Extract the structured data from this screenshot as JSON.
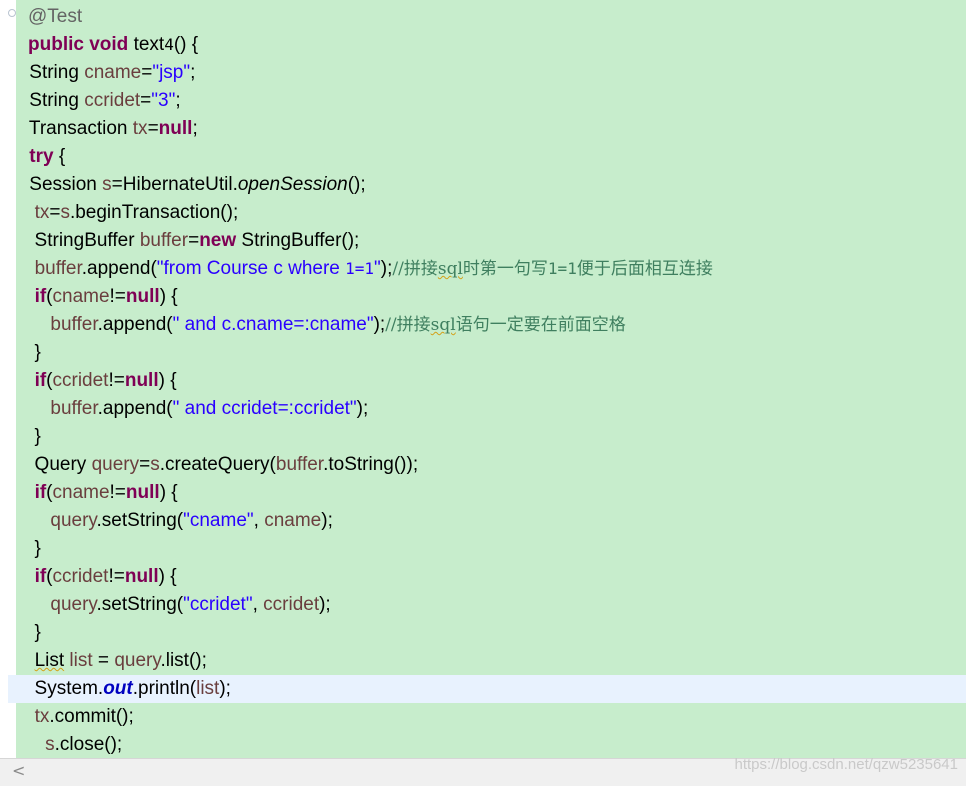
{
  "editor": {
    "lines": [
      {
        "tokens": [
          {
            "t": "@Test",
            "c": "ann"
          }
        ]
      },
      {
        "tokens": [
          {
            "t": "public",
            "c": "kw"
          },
          {
            "t": " "
          },
          {
            "t": "void",
            "c": "kw"
          },
          {
            "t": " text"
          },
          {
            "t": "4",
            "c": "num"
          },
          {
            "t": "() {"
          }
        ]
      },
      {
        "tokens": [
          {
            "t": " String "
          },
          {
            "t": "cname",
            "c": "var"
          },
          {
            "t": "="
          },
          {
            "t": "\"jsp\"",
            "c": "str"
          },
          {
            "t": ";"
          }
        ]
      },
      {
        "tokens": [
          {
            "t": " String "
          },
          {
            "t": "ccridet",
            "c": "var"
          },
          {
            "t": "="
          },
          {
            "t": "\"3\"",
            "c": "str"
          },
          {
            "t": ";"
          }
        ]
      },
      {
        "tokens": [
          {
            "t": " Transaction "
          },
          {
            "t": "tx",
            "c": "var"
          },
          {
            "t": "="
          },
          {
            "t": "null",
            "c": "kw"
          },
          {
            "t": ";"
          }
        ]
      },
      {
        "tokens": [
          {
            "t": " "
          },
          {
            "t": "try",
            "c": "kw"
          },
          {
            "t": " {"
          }
        ]
      },
      {
        "tokens": [
          {
            "t": " Session "
          },
          {
            "t": "s",
            "c": "var"
          },
          {
            "t": "=HibernateUtil."
          },
          {
            "t": "openSession",
            "c": "it"
          },
          {
            "t": "();"
          }
        ]
      },
      {
        "tokens": [
          {
            "t": "  "
          },
          {
            "t": "tx",
            "c": "var"
          },
          {
            "t": "="
          },
          {
            "t": "s",
            "c": "var"
          },
          {
            "t": ".beginTransaction();"
          }
        ]
      },
      {
        "tokens": [
          {
            "t": "  StringBuffer "
          },
          {
            "t": "buffer",
            "c": "var"
          },
          {
            "t": "="
          },
          {
            "t": "new",
            "c": "kw"
          },
          {
            "t": " StringBuffer();"
          }
        ]
      },
      {
        "tokens": [
          {
            "t": "  "
          },
          {
            "t": "buffer",
            "c": "var"
          },
          {
            "t": ".append("
          },
          {
            "t": "\"from Course c where ",
            "c": "str"
          },
          {
            "t": "1=1",
            "c": "str num"
          },
          {
            "t": "\"",
            "c": "str"
          },
          {
            "t": ");"
          },
          {
            "t": "//拼接",
            "c": "cmt"
          },
          {
            "t": "sql",
            "c": "cmt squig"
          },
          {
            "t": "时第一句写",
            "c": "cmt"
          },
          {
            "t": "1=1",
            "c": "cmt num"
          },
          {
            "t": "便于后面相互连接",
            "c": "cmt"
          }
        ]
      },
      {
        "tokens": [
          {
            "t": "  "
          },
          {
            "t": "if",
            "c": "kw"
          },
          {
            "t": "("
          },
          {
            "t": "cname",
            "c": "var"
          },
          {
            "t": "!="
          },
          {
            "t": "null",
            "c": "kw"
          },
          {
            "t": ") {"
          }
        ]
      },
      {
        "tokens": [
          {
            "t": "     "
          },
          {
            "t": "buffer",
            "c": "var"
          },
          {
            "t": ".append("
          },
          {
            "t": "\" and c.cname=:cname\"",
            "c": "str"
          },
          {
            "t": ");"
          },
          {
            "t": "//拼接",
            "c": "cmt"
          },
          {
            "t": "sql",
            "c": "cmt squig"
          },
          {
            "t": "语句一定要在前面空格",
            "c": "cmt"
          }
        ]
      },
      {
        "tokens": [
          {
            "t": "  }"
          }
        ]
      },
      {
        "tokens": [
          {
            "t": "  "
          },
          {
            "t": "if",
            "c": "kw"
          },
          {
            "t": "("
          },
          {
            "t": "ccridet",
            "c": "var"
          },
          {
            "t": "!="
          },
          {
            "t": "null",
            "c": "kw"
          },
          {
            "t": ") {"
          }
        ]
      },
      {
        "tokens": [
          {
            "t": "     "
          },
          {
            "t": "buffer",
            "c": "var"
          },
          {
            "t": ".append("
          },
          {
            "t": "\" and ccridet=:ccridet\"",
            "c": "str"
          },
          {
            "t": ");"
          }
        ]
      },
      {
        "tokens": [
          {
            "t": "  }"
          }
        ]
      },
      {
        "tokens": [
          {
            "t": "  Query "
          },
          {
            "t": "query",
            "c": "var"
          },
          {
            "t": "="
          },
          {
            "t": "s",
            "c": "var"
          },
          {
            "t": ".createQuery("
          },
          {
            "t": "buffer",
            "c": "var"
          },
          {
            "t": ".toString());"
          }
        ]
      },
      {
        "tokens": [
          {
            "t": "  "
          },
          {
            "t": "if",
            "c": "kw"
          },
          {
            "t": "("
          },
          {
            "t": "cname",
            "c": "var"
          },
          {
            "t": "!="
          },
          {
            "t": "null",
            "c": "kw"
          },
          {
            "t": ") {"
          }
        ]
      },
      {
        "tokens": [
          {
            "t": "     "
          },
          {
            "t": "query",
            "c": "var"
          },
          {
            "t": ".setString("
          },
          {
            "t": "\"cname\"",
            "c": "str"
          },
          {
            "t": ", "
          },
          {
            "t": "cname",
            "c": "var"
          },
          {
            "t": ");"
          }
        ]
      },
      {
        "tokens": [
          {
            "t": "  }"
          }
        ]
      },
      {
        "tokens": [
          {
            "t": "  "
          },
          {
            "t": "if",
            "c": "kw"
          },
          {
            "t": "("
          },
          {
            "t": "ccridet",
            "c": "var"
          },
          {
            "t": "!="
          },
          {
            "t": "null",
            "c": "kw"
          },
          {
            "t": ") {"
          }
        ]
      },
      {
        "tokens": [
          {
            "t": "     "
          },
          {
            "t": "query",
            "c": "var"
          },
          {
            "t": ".setString("
          },
          {
            "t": "\"ccridet\"",
            "c": "str"
          },
          {
            "t": ", "
          },
          {
            "t": "ccridet",
            "c": "var"
          },
          {
            "t": ");"
          }
        ]
      },
      {
        "tokens": [
          {
            "t": "  }"
          }
        ]
      },
      {
        "tokens": [
          {
            "t": "  "
          },
          {
            "t": "List",
            "c": "squig"
          },
          {
            "t": " "
          },
          {
            "t": "list",
            "c": "var"
          },
          {
            "t": " = "
          },
          {
            "t": "query",
            "c": "var"
          },
          {
            "t": ".list();"
          }
        ]
      },
      {
        "tokens": [
          {
            "t": "  System."
          },
          {
            "t": "out",
            "c": "fld"
          },
          {
            "t": ".println("
          },
          {
            "t": "list",
            "c": "var"
          },
          {
            "t": ");"
          }
        ],
        "current": true
      },
      {
        "tokens": [
          {
            "t": "  "
          },
          {
            "t": "tx",
            "c": "var"
          },
          {
            "t": ".commit();"
          }
        ]
      },
      {
        "tokens": [
          {
            "t": "    "
          },
          {
            "t": "s",
            "c": "var"
          },
          {
            "t": ".close();"
          }
        ]
      }
    ]
  },
  "scrollbar": {
    "left_arrow": "<"
  },
  "watermark": "https://blog.csdn.net/qzw5235641",
  "colors": {
    "background": "#c7edcc",
    "current_line": "#e8f2fe",
    "keyword": "#7f0055",
    "string": "#2a00ff",
    "local_variable": "#6a3e3e",
    "annotation": "#646464",
    "comment": "#3f7f5f",
    "static_field": "#0000c0"
  }
}
